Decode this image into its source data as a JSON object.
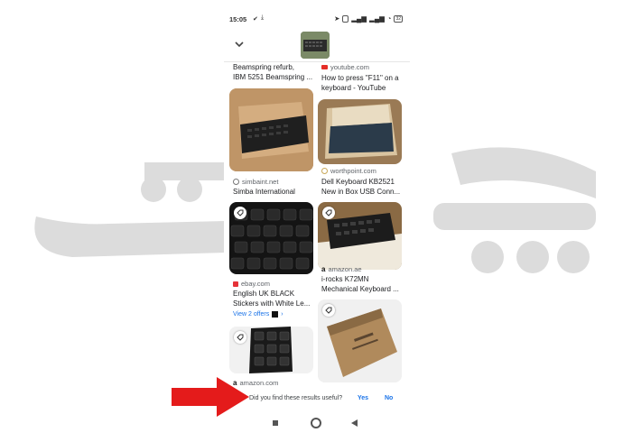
{
  "status_bar": {
    "time": "15:05",
    "battery": "32"
  },
  "results": [
    {
      "source": "",
      "title_lines": [
        "Beamspring refurb,",
        "IBM 5251 Beamspring ..."
      ]
    },
    {
      "source": "youtube.com",
      "title_lines": [
        "How to press \"F11\" on a",
        "keyboard - YouTube"
      ]
    },
    {
      "source": "simbaint.net",
      "title_lines": [
        "Simba International"
      ]
    },
    {
      "source": "worthpoint.com",
      "title_lines": [
        "Dell Keyboard KB2521",
        "New in Box USB Conn..."
      ]
    },
    {
      "source": "ebay.com",
      "title_lines": [
        "English UK BLACK",
        "Stickers with White Le..."
      ],
      "offers": "View 2 offers"
    },
    {
      "source": "amazon.ae",
      "title_lines": [
        "i-rocks K72MN",
        "Mechanical Keyboard ..."
      ]
    },
    {
      "source": "amazon.com"
    }
  ],
  "feedback": {
    "question": "Did you find these results useful?",
    "yes": "Yes",
    "no": "No"
  },
  "colors": {
    "accent": "#1a73e8",
    "arrow": "#e41b1b",
    "watermark": "#dcdcdc"
  }
}
